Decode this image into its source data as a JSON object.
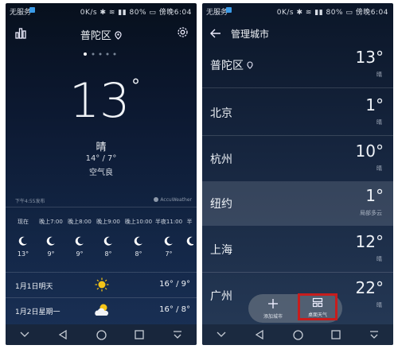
{
  "status_bar": {
    "carrier": "无服务",
    "right_text": "0K/s ✱ ≋ ▮▮ 80% ▭ 傍晚6:04"
  },
  "left": {
    "city": "普陀区",
    "temperature": "13",
    "degree": "°",
    "condition": "晴",
    "range": "14° / 7°",
    "air_quality": "空气良",
    "update_time": "下午4:55发布",
    "provider": "AccuWeather",
    "hourly": [
      {
        "label": "现在",
        "temp": "13°"
      },
      {
        "label": "晚上7:00",
        "temp": "9°"
      },
      {
        "label": "晚上8:00",
        "temp": "9°"
      },
      {
        "label": "晚上9:00",
        "temp": "8°"
      },
      {
        "label": "晚上10:00",
        "temp": "8°"
      },
      {
        "label": "半夜11:00",
        "temp": "7°"
      },
      {
        "label": "半",
        "temp": ""
      }
    ],
    "daily": [
      {
        "date": "1月1日明天",
        "temps": "16° / 9°",
        "icon": "sun-icon"
      },
      {
        "date": "1月2日星期一",
        "temps": "16° / 8°",
        "icon": "partly-cloudy-icon"
      }
    ]
  },
  "right": {
    "title": "管理城市",
    "cities": [
      {
        "name": "普陀区",
        "temp": "13°",
        "cond": "晴"
      },
      {
        "name": "北京",
        "temp": "1°",
        "cond": "晴"
      },
      {
        "name": "杭州",
        "temp": "10°",
        "cond": "晴"
      },
      {
        "name": "纽约",
        "temp": "1°",
        "cond": "局部多云"
      },
      {
        "name": "上海",
        "temp": "12°",
        "cond": "晴"
      },
      {
        "name": "广州",
        "temp": "22°",
        "cond": "晴"
      }
    ],
    "add_city_label": "添加城市",
    "widget_label": "桌面天气"
  },
  "colors": {
    "highlight_box": "#c71d1d",
    "accent": "#3a9be8"
  }
}
